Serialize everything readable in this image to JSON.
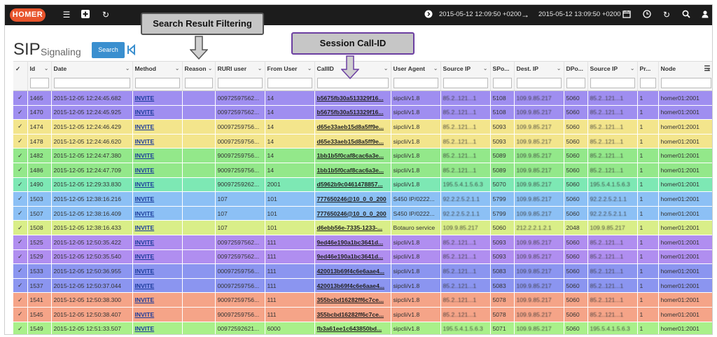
{
  "topbar": {
    "logo": "HOMER",
    "from_time": "2015-05-12 12:09:50 +0200",
    "to_time": "2015-05-12 13:09:50 +0200"
  },
  "page": {
    "title": "SIP",
    "subtitle": "Signaling",
    "search_label": "Search"
  },
  "callouts": {
    "filtering": "Search Result Filtering",
    "callid": "Session Call-ID"
  },
  "colors": {
    "purple": "#9f8ef0",
    "yellow": "#f3e58c",
    "green": "#93e88a",
    "teal": "#7de8b4",
    "blue": "#8cc0f5",
    "lime": "#d9ee88",
    "violet": "#b08ef0",
    "indigo": "#8b95f0",
    "salmon": "#f5a488",
    "lightgreen": "#a9f08a"
  },
  "columns": [
    "Id",
    "Date",
    "Method",
    "Reason",
    "RURI user",
    "From User",
    "CallID",
    "User Agent",
    "Source IP",
    "SPo...",
    "Dest. IP",
    "DPo...",
    "Source IP",
    "Pr...",
    "Node"
  ],
  "rows": [
    {
      "id": "1465",
      "date": "2015-12-05 12:24:45.682",
      "method": "INVITE",
      "reason": "",
      "ruri": "00972597562...",
      "from": "14",
      "callid": "b5675fb30a513329f16...",
      "ua": "sipcli/v1.8",
      "src": "85.2..121...1",
      "sport": "5108",
      "dst": "109.9.85.217",
      "dport": "5060",
      "src2": "85.2..121...1",
      "proto": "1",
      "node": "homer01:2001",
      "color": "purple"
    },
    {
      "id": "1470",
      "date": "2015-12-05 12:24:45.925",
      "method": "INVITE",
      "reason": "",
      "ruri": "00972597562...",
      "from": "14",
      "callid": "b5675fb30a513329f16...",
      "ua": "sipcli/v1.8",
      "src": "85.2..121...1",
      "sport": "5108",
      "dst": "109.9.85.217",
      "dport": "5060",
      "src2": "85.2..121...1",
      "proto": "1",
      "node": "homer01:2001",
      "color": "purple"
    },
    {
      "id": "1474",
      "date": "2015-12-05 12:24:46.429",
      "method": "INVITE",
      "reason": "",
      "ruri": "00097259756...",
      "from": "14",
      "callid": "d65e33aeb15d8a5ff9e...",
      "ua": "sipcli/v1.8",
      "src": "85.2..121...1",
      "sport": "5093",
      "dst": "109.9.85.217",
      "dport": "5060",
      "src2": "85.2..121...1",
      "proto": "1",
      "node": "homer01:2001",
      "color": "yellow"
    },
    {
      "id": "1478",
      "date": "2015-12-05 12:24:46.620",
      "method": "INVITE",
      "reason": "",
      "ruri": "00097259756...",
      "from": "14",
      "callid": "d65e33aeb15d8a5ff9e...",
      "ua": "sipcli/v1.8",
      "src": "85.2..121...1",
      "sport": "5093",
      "dst": "109.9.85.217",
      "dport": "5060",
      "src2": "85.2..121...1",
      "proto": "1",
      "node": "homer01:2001",
      "color": "yellow"
    },
    {
      "id": "1482",
      "date": "2015-12-05 12:24:47.380",
      "method": "INVITE",
      "reason": "",
      "ruri": "90097259756...",
      "from": "14",
      "callid": "1bb1b5f0caf8cac6a3e...",
      "ua": "sipcli/v1.8",
      "src": "85.2..121...1",
      "sport": "5089",
      "dst": "109.9.85.217",
      "dport": "5060",
      "src2": "85.2..121...1",
      "proto": "1",
      "node": "homer01:2001",
      "color": "green"
    },
    {
      "id": "1486",
      "date": "2015-12-05 12:24:47.709",
      "method": "INVITE",
      "reason": "",
      "ruri": "90097259756...",
      "from": "14",
      "callid": "1bb1b5f0caf8cac6a3e...",
      "ua": "sipcli/v1.8",
      "src": "85.2..121...1",
      "sport": "5089",
      "dst": "109.9.85.217",
      "dport": "5060",
      "src2": "85.2..121...1",
      "proto": "1",
      "node": "homer01:2001",
      "color": "green"
    },
    {
      "id": "1490",
      "date": "2015-12-05 12:29:33.830",
      "method": "INVITE",
      "reason": "",
      "ruri": "90097259262...",
      "from": "2001",
      "callid": "d5962b9c0461478857...",
      "ua": "sipcli/v1.8",
      "src": "195.5.4.1.5.6.3",
      "sport": "5070",
      "dst": "109.9.85.217",
      "dport": "5060",
      "src2": "195.5.4.1.5.6.3",
      "proto": "1",
      "node": "homer01:2001",
      "color": "teal"
    },
    {
      "id": "1503",
      "date": "2015-12-05 12:38:16.216",
      "method": "INVITE",
      "reason": "",
      "ruri": "107",
      "from": "101",
      "callid": "777650246@10_0_0_200",
      "ua": "S450 IP/0222...",
      "src": "92.2.2.5.2.1.1",
      "sport": "5799",
      "dst": "109.9.85.217",
      "dport": "5060",
      "src2": "92.2.2.5.2.1.1",
      "proto": "1",
      "node": "homer01:2001",
      "color": "blue"
    },
    {
      "id": "1507",
      "date": "2015-12-05 12:38:16.409",
      "method": "INVITE",
      "reason": "",
      "ruri": "107",
      "from": "101",
      "callid": "777650246@10_0_0_200",
      "ua": "S450 IP/0222...",
      "src": "92.2.2.5.2.1.1",
      "sport": "5799",
      "dst": "109.9.85.217",
      "dport": "5060",
      "src2": "92.2.2.5.2.1.1",
      "proto": "1",
      "node": "homer01:2001",
      "color": "blue"
    },
    {
      "id": "1508",
      "date": "2015-12-05 12:38:16.433",
      "method": "INVITE",
      "reason": "",
      "ruri": "107",
      "from": "101",
      "callid": "d6ebb56e-7335-1233-...",
      "ua": "Botauro service",
      "src": "109.9.85.217",
      "sport": "5060",
      "dst": "212.2.2.1.2.1",
      "dport": "2048",
      "src2": "109.9.85.217",
      "proto": "1",
      "node": "homer01:2001",
      "color": "lime"
    },
    {
      "id": "1525",
      "date": "2015-12-05 12:50:35.422",
      "method": "INVITE",
      "reason": "",
      "ruri": "00972597562...",
      "from": "111",
      "callid": "9ed46e190a1bc3641d...",
      "ua": "sipcli/v1.8",
      "src": "85.2..121...1",
      "sport": "5093",
      "dst": "109.9.85.217",
      "dport": "5060",
      "src2": "85.2..121...1",
      "proto": "1",
      "node": "homer01:2001",
      "color": "violet"
    },
    {
      "id": "1529",
      "date": "2015-12-05 12:50:35.540",
      "method": "INVITE",
      "reason": "",
      "ruri": "00972597562...",
      "from": "111",
      "callid": "9ed46e190a1bc3641d...",
      "ua": "sipcli/v1.8",
      "src": "85.2..121...1",
      "sport": "5093",
      "dst": "109.9.85.217",
      "dport": "5060",
      "src2": "85.2..121...1",
      "proto": "1",
      "node": "homer01:2001",
      "color": "violet"
    },
    {
      "id": "1533",
      "date": "2015-12-05 12:50:36.955",
      "method": "INVITE",
      "reason": "",
      "ruri": "00097259756...",
      "from": "111",
      "callid": "420013b69f4c6e6aae4...",
      "ua": "sipcli/v1.8",
      "src": "85.2..121...1",
      "sport": "5083",
      "dst": "109.9.85.217",
      "dport": "5060",
      "src2": "85.2..121...1",
      "proto": "1",
      "node": "homer01:2001",
      "color": "indigo"
    },
    {
      "id": "1537",
      "date": "2015-12-05 12:50:37.044",
      "method": "INVITE",
      "reason": "",
      "ruri": "00097259756...",
      "from": "111",
      "callid": "420013b69f4c6e6aae4...",
      "ua": "sipcli/v1.8",
      "src": "85.2..121...1",
      "sport": "5083",
      "dst": "109.9.85.217",
      "dport": "5060",
      "src2": "85.2..121...1",
      "proto": "1",
      "node": "homer01:2001",
      "color": "indigo"
    },
    {
      "id": "1541",
      "date": "2015-12-05 12:50:38.300",
      "method": "INVITE",
      "reason": "",
      "ruri": "90097259756...",
      "from": "111",
      "callid": "355bcbd16282ff6c7ce...",
      "ua": "sipcli/v1.8",
      "src": "85.2..121...1",
      "sport": "5078",
      "dst": "109.9.85.217",
      "dport": "5060",
      "src2": "85.2..121...1",
      "proto": "1",
      "node": "homer01:2001",
      "color": "salmon"
    },
    {
      "id": "1545",
      "date": "2015-12-05 12:50:38.407",
      "method": "INVITE",
      "reason": "",
      "ruri": "90097259756...",
      "from": "111",
      "callid": "355bcbd16282ff6c7ce...",
      "ua": "sipcli/v1.8",
      "src": "85.2..121...1",
      "sport": "5078",
      "dst": "109.9.85.217",
      "dport": "5060",
      "src2": "85.2..121...1",
      "proto": "1",
      "node": "homer01:2001",
      "color": "salmon"
    },
    {
      "id": "1549",
      "date": "2015-12-05 12:51:33.507",
      "method": "INVITE",
      "reason": "",
      "ruri": "00972592621...",
      "from": "6000",
      "callid": "fb3a61ee1c643850bd...",
      "ua": "sipcli/v1.8",
      "src": "195.5.4.1.5.6.3",
      "sport": "5071",
      "dst": "109.9.85.217",
      "dport": "5060",
      "src2": "195.5.4.1.5.6.3",
      "proto": "1",
      "node": "homer01:2001",
      "color": "lightgreen"
    }
  ]
}
